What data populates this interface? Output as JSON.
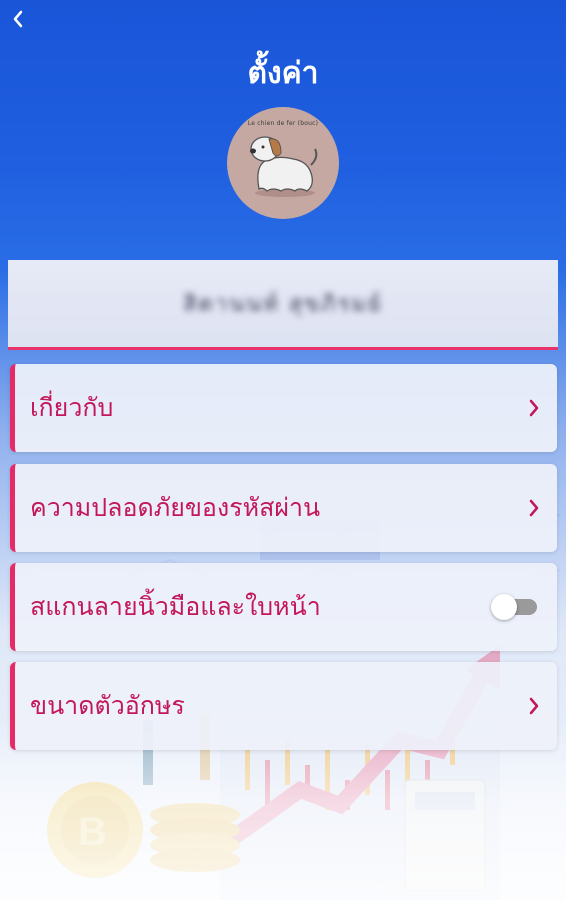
{
  "header": {
    "title": "ตั้งค่า",
    "back_icon": "chevron-left-icon"
  },
  "profile": {
    "avatar_caption": "Le chien de fer (bouc)",
    "user_name": "สิตานนท์ สุขภิรมย์"
  },
  "menu": [
    {
      "label": "เกี่ยวกับ",
      "control": "chevron-right-icon"
    },
    {
      "label": "ความปลอดภัยของรหัสผ่าน",
      "control": "chevron-right-icon"
    },
    {
      "label": "สแกนลายนิ้วมือและใบหน้า",
      "control": "toggle",
      "toggle_on": false
    },
    {
      "label": "ขนาดตัวอักษร",
      "control": "chevron-right-icon"
    }
  ],
  "colors": {
    "accent": "#e62a66",
    "label": "#c3175a",
    "header_blue": "#1a55d8"
  }
}
